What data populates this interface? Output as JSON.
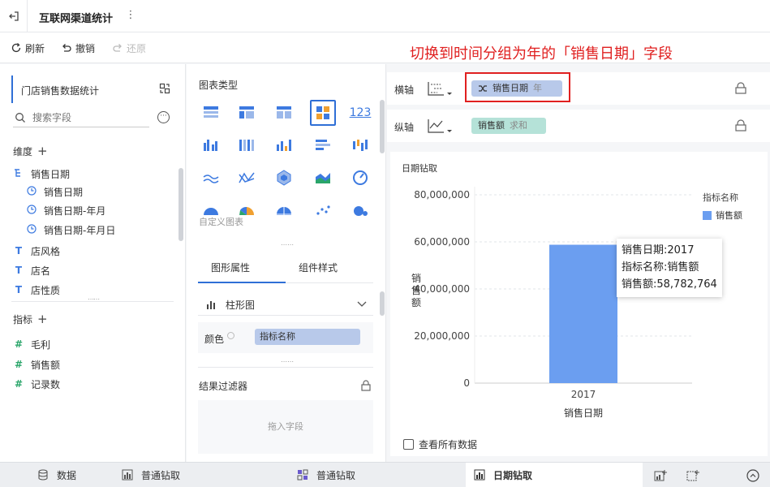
{
  "header": {
    "title": "互联网渠道统计"
  },
  "toolbar": {
    "refresh": "刷新",
    "undo": "撤销",
    "redo": "还原"
  },
  "annotation": "切换到时间分组为年的「销售日期」字段",
  "left_panel": {
    "dataset": "门店销售数据统计",
    "search_placeholder": "搜索字段",
    "dimension_title": "维度",
    "dimensions": [
      {
        "label": "销售日期",
        "icon": "hierarchy-icon"
      },
      {
        "label": "销售日期",
        "icon": "clock-icon"
      },
      {
        "label": "销售日期-年月",
        "icon": "clock-icon"
      },
      {
        "label": "销售日期-年月日",
        "icon": "clock-icon"
      },
      {
        "label": "店风格",
        "icon": "text-icon"
      },
      {
        "label": "店名",
        "icon": "text-icon"
      },
      {
        "label": "店性质",
        "icon": "text-icon"
      }
    ],
    "measure_title": "指标",
    "measures": [
      {
        "label": "毛利",
        "icon": "hash-icon"
      },
      {
        "label": "销售额",
        "icon": "hash-icon"
      },
      {
        "label": "记录数",
        "icon": "hash-icon"
      }
    ]
  },
  "mid_panel": {
    "chart_type_title": "图表类型",
    "custom_chart": "自定义图表",
    "tabs": [
      "图形属性",
      "组件样式"
    ],
    "chart_style": "柱形图",
    "color_label": "颜色",
    "color_value": "指标名称",
    "filter_title": "结果过滤器",
    "filter_placeholder": "拖入字段"
  },
  "axes": {
    "x_label": "横轴",
    "x_field": "销售日期",
    "x_group": "年",
    "y_label": "纵轴",
    "y_field": "销售额",
    "y_agg": "求和"
  },
  "chart": {
    "title": "日期钻取",
    "show_all": "查看所有数据",
    "tooltip": [
      "销售日期:2017",
      "指标名称:销售额",
      "销售额:58,782,764"
    ]
  },
  "chart_data": {
    "type": "bar",
    "categories": [
      "2017"
    ],
    "series": [
      {
        "name": "销售额",
        "values": [
          58782764
        ]
      }
    ],
    "xlabel": "销售日期",
    "ylabel": "销售额",
    "ylim": [
      0,
      80000000
    ],
    "yticks": [
      "0",
      "20,000,000",
      "40,000,000",
      "60,000,000",
      "80,000,000"
    ],
    "legend_title": "指标名称",
    "legend_position": "top-right",
    "bar_color": "#6b9ef0",
    "grid": true
  },
  "bottom_tabs": [
    "数据",
    "普通钻取",
    "普通钻取",
    "日期钻取"
  ],
  "colors": {
    "accent": "#2f6fd6",
    "highlight": "#e02020"
  }
}
